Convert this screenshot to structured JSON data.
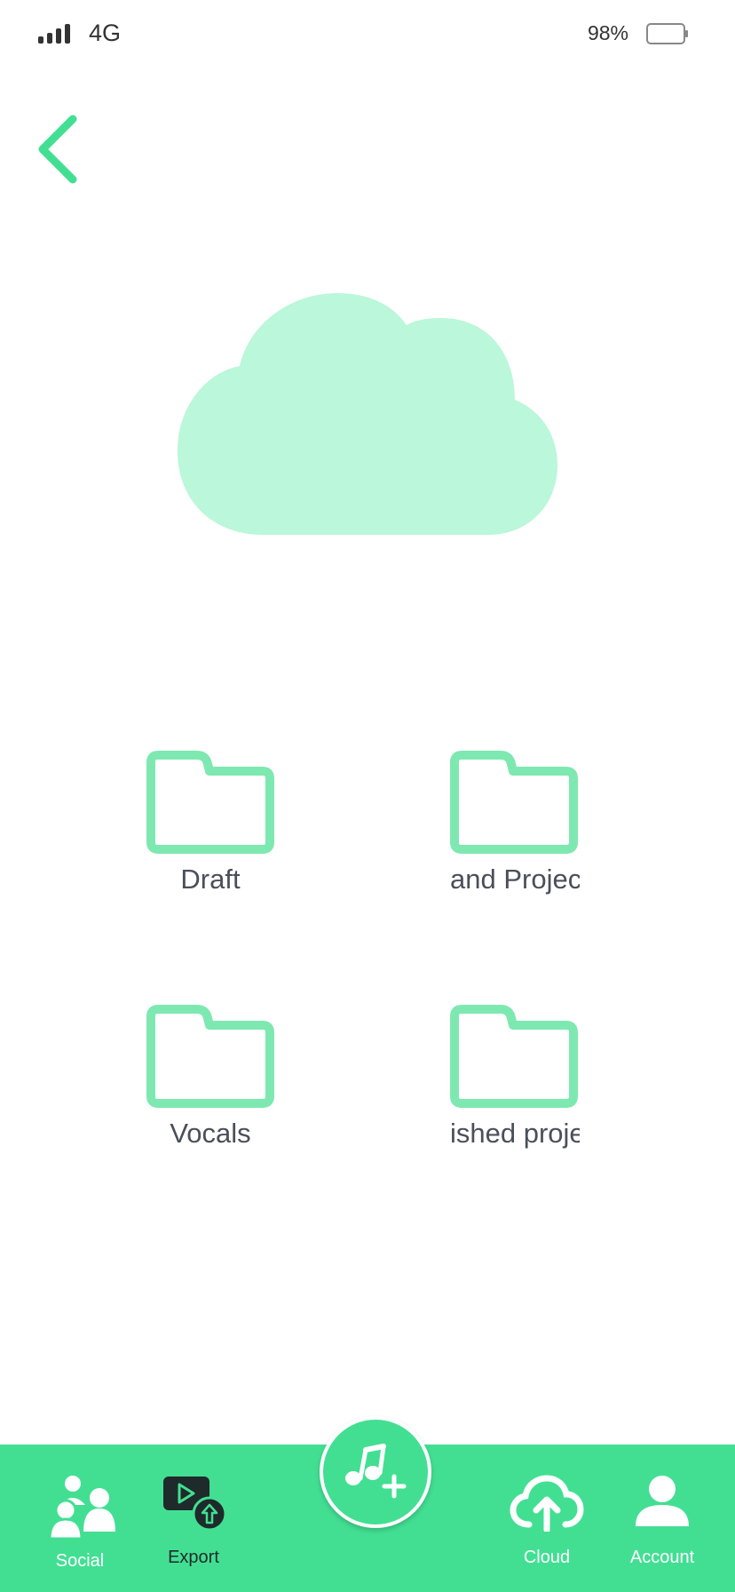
{
  "status_bar": {
    "network": "4G",
    "battery_percent": "98%"
  },
  "colors": {
    "accent": "#42df93",
    "cloud": "#bbf7da",
    "folder_stroke": "#7ee8b1",
    "text": "#4a4f5a"
  },
  "folders": [
    {
      "label": "Draft"
    },
    {
      "label": "and Project"
    },
    {
      "label": "Vocals"
    },
    {
      "label": "ished proje"
    }
  ],
  "tab_bar": {
    "social_label": "Social",
    "export_label": "Export",
    "cloud_label": "Cloud",
    "account_label": "Account"
  },
  "icons": {
    "back": "chevron-left-icon",
    "hero": "cloud-icon",
    "fab": "music-add-icon"
  }
}
